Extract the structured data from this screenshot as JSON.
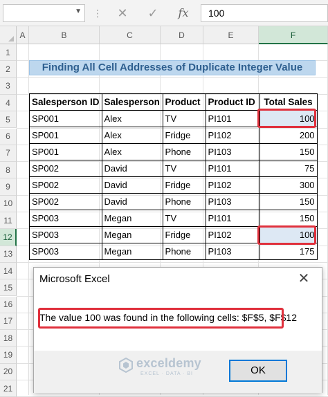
{
  "formula_bar": {
    "name_box": "",
    "cancel_icon": "cancel-icon",
    "enter_icon": "checkmark-icon",
    "fx_label": "fx",
    "formula_value": "100"
  },
  "columns": [
    "A",
    "B",
    "C",
    "D",
    "E",
    "F"
  ],
  "rows": [
    "1",
    "2",
    "3",
    "4",
    "5",
    "6",
    "7",
    "8",
    "9",
    "10",
    "11",
    "12",
    "13",
    "14",
    "15",
    "16",
    "17",
    "18",
    "19",
    "20",
    "21"
  ],
  "selected_column": "F",
  "selected_row": "12",
  "title": "Finding All Cell Addresses of Duplicate Integer Value",
  "table": {
    "headers": [
      "Salesperson ID",
      "Salesperson",
      "Product",
      "Product ID",
      "Total Sales"
    ],
    "rows": [
      [
        "SP001",
        "Alex",
        "TV",
        "PI101",
        "100"
      ],
      [
        "SP001",
        "Alex",
        "Fridge",
        "PI102",
        "200"
      ],
      [
        "SP001",
        "Alex",
        "Phone",
        "PI103",
        "150"
      ],
      [
        "SP002",
        "David",
        "TV",
        "PI101",
        "75"
      ],
      [
        "SP002",
        "David",
        "Fridge",
        "PI102",
        "300"
      ],
      [
        "SP002",
        "David",
        "Phone",
        "PI103",
        "150"
      ],
      [
        "SP003",
        "Megan",
        "TV",
        "PI101",
        "150"
      ],
      [
        "SP003",
        "Megan",
        "Fridge",
        "PI102",
        "100"
      ],
      [
        "SP003",
        "Megan",
        "Phone",
        "PI103",
        "175"
      ]
    ]
  },
  "dialog": {
    "title": "Microsoft Excel",
    "message": "The value 100 was found in the following cells: $F$5, $F$12",
    "ok_label": "OK"
  },
  "watermark": {
    "name": "exceldemy",
    "tagline": "EXCEL · DATA · BI"
  },
  "colors": {
    "title_fill": "#bdd7ee",
    "highlight_border": "#e0303c",
    "selection_green": "#217346",
    "ok_border": "#0078d7"
  }
}
